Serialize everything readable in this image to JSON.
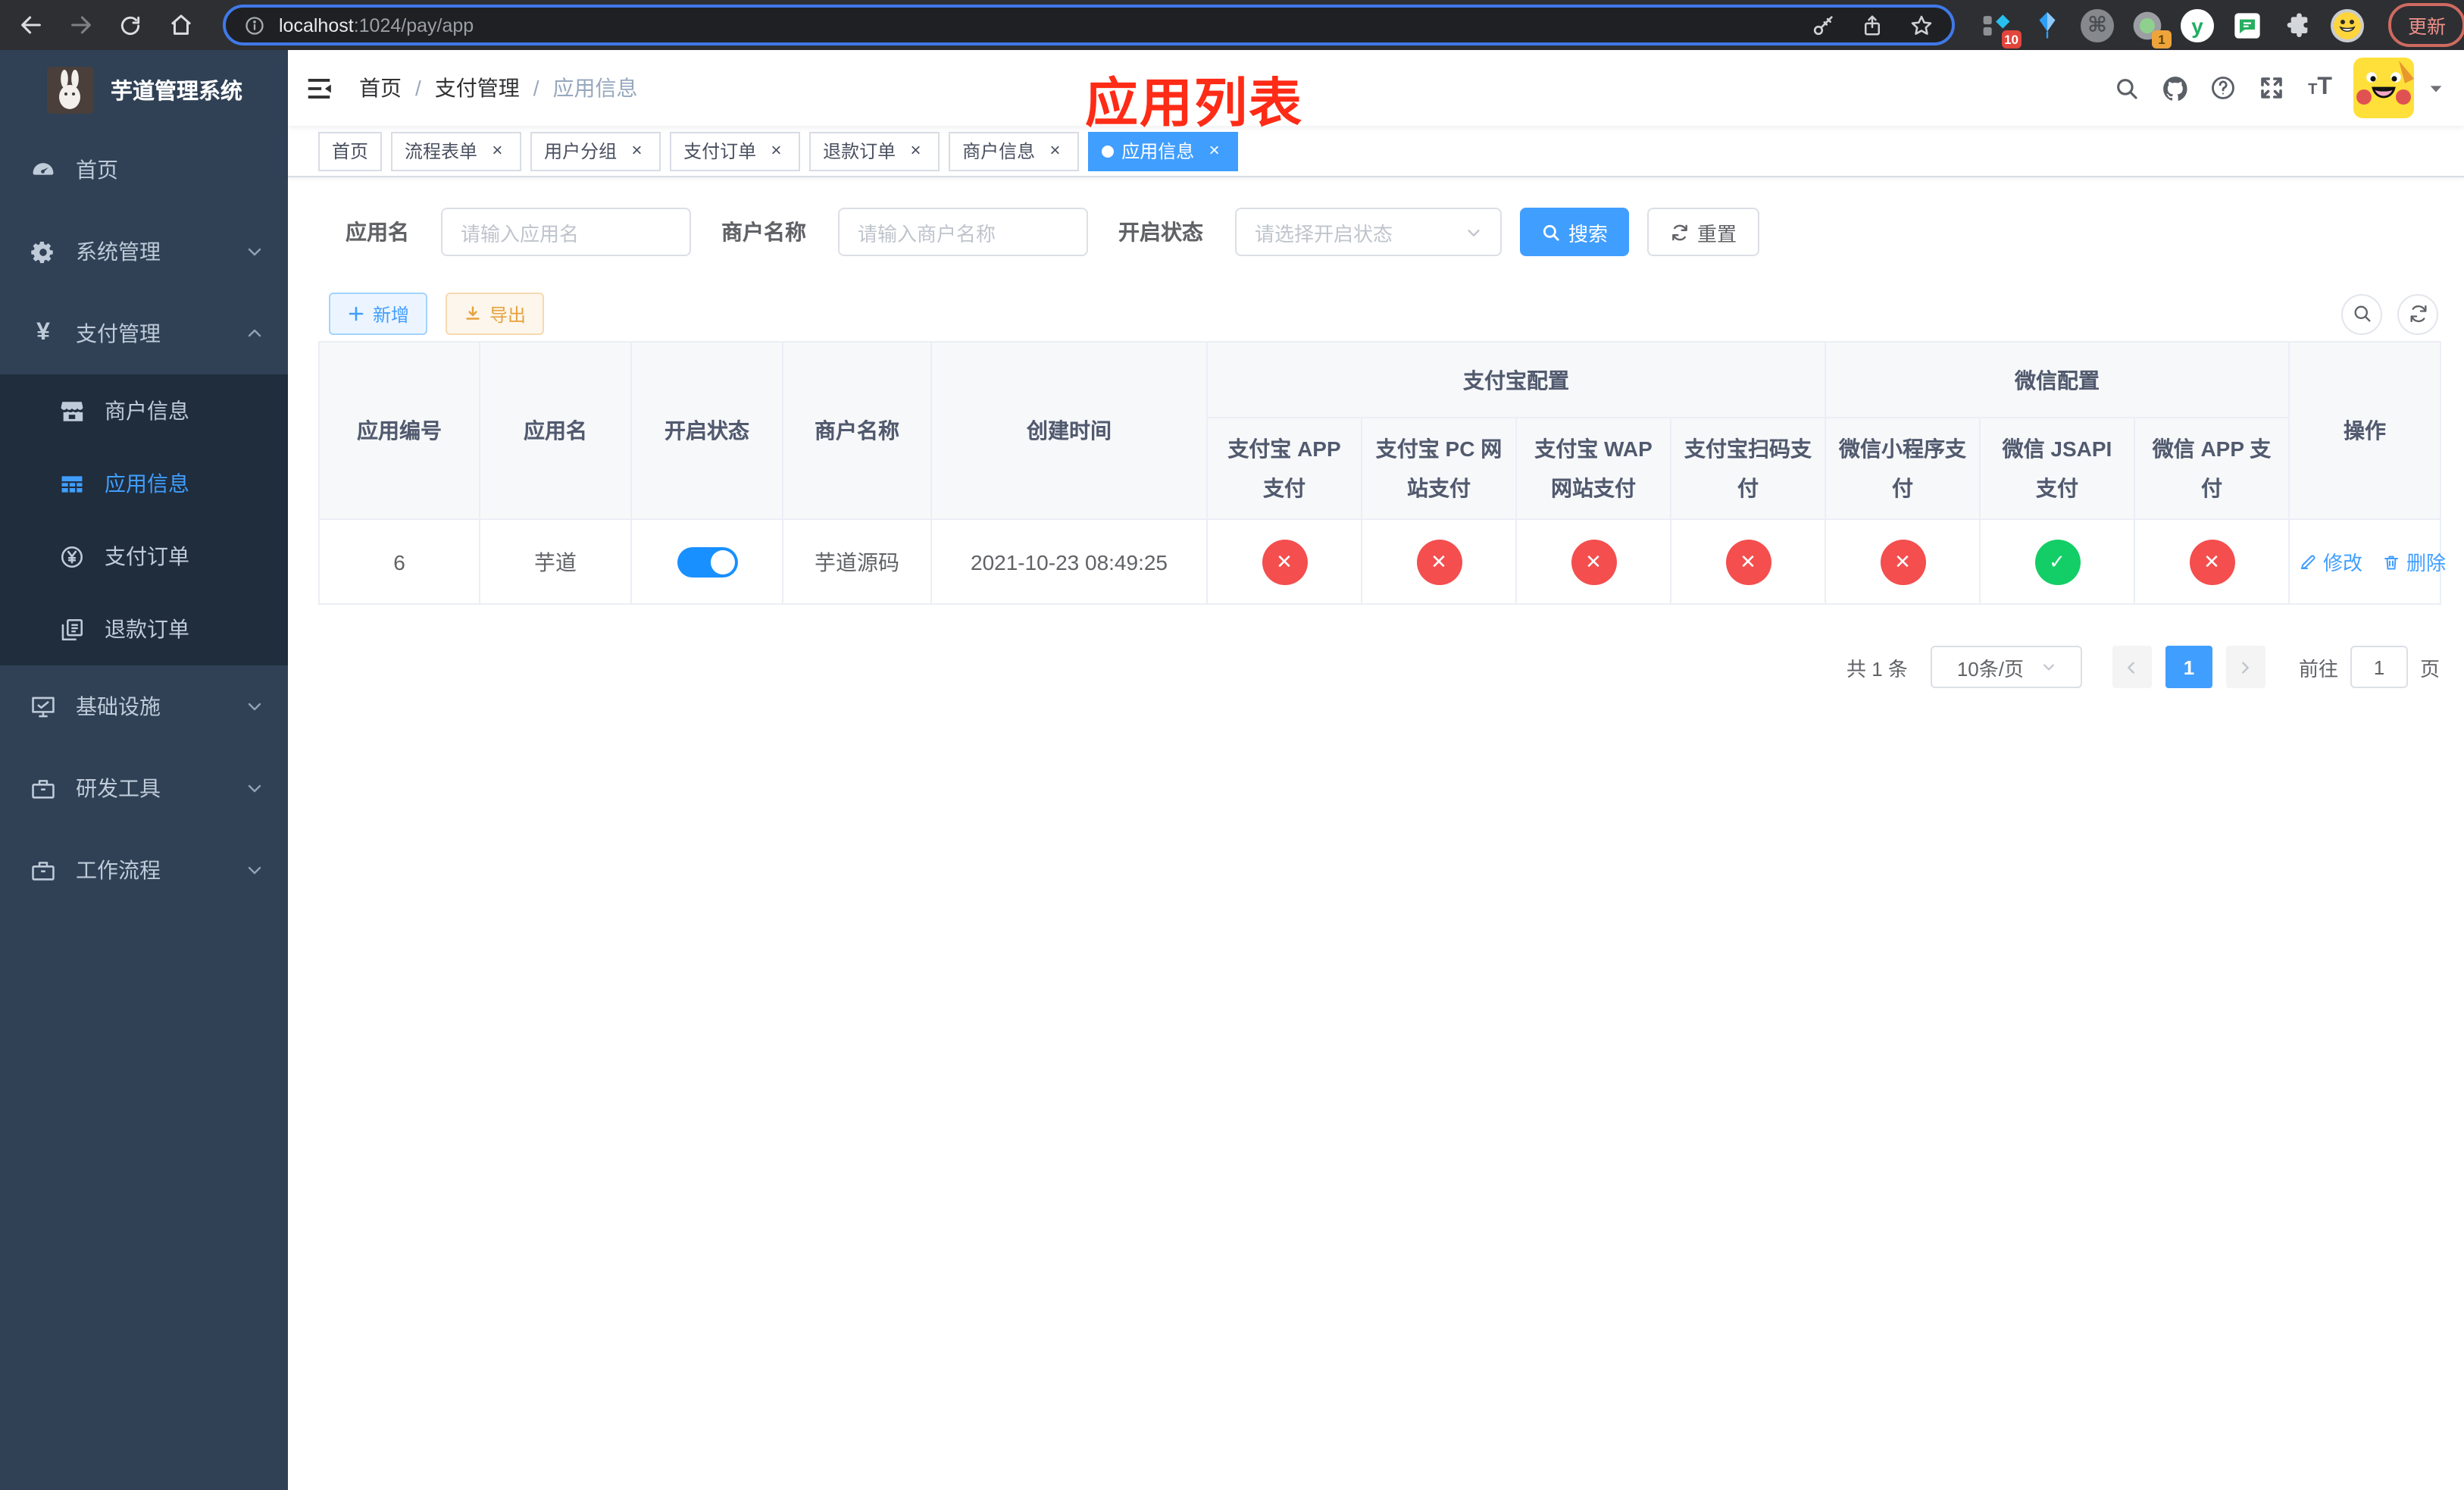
{
  "browser": {
    "url_host": "localhost",
    "url_rest": ":1024/pay/app",
    "update_label": "更新",
    "ext_badges": {
      "pinned": "10",
      "recorder": "1"
    }
  },
  "annotation": "应用列表",
  "sidebar": {
    "title": "芋道管理系统",
    "items_top": [
      {
        "label": "首页"
      },
      {
        "label": "系统管理"
      },
      {
        "label": "支付管理"
      }
    ],
    "payment_children": [
      {
        "label": "商户信息",
        "active": false
      },
      {
        "label": "应用信息",
        "active": true
      },
      {
        "label": "支付订单",
        "active": false
      },
      {
        "label": "退款订单",
        "active": false
      }
    ],
    "items_bottom": [
      {
        "label": "基础设施"
      },
      {
        "label": "研发工具"
      },
      {
        "label": "工作流程"
      }
    ]
  },
  "navbar": {
    "breadcrumb": [
      "首页",
      "支付管理",
      "应用信息"
    ],
    "separator": "/"
  },
  "tabs": [
    {
      "label": "首页",
      "closable": false,
      "active": false
    },
    {
      "label": "流程表单",
      "closable": true,
      "active": false
    },
    {
      "label": "用户分组",
      "closable": true,
      "active": false
    },
    {
      "label": "支付订单",
      "closable": true,
      "active": false
    },
    {
      "label": "退款订单",
      "closable": true,
      "active": false
    },
    {
      "label": "商户信息",
      "closable": true,
      "active": false
    },
    {
      "label": "应用信息",
      "closable": true,
      "active": true
    }
  ],
  "filters": {
    "app_name": {
      "label": "应用名",
      "placeholder": "请输入应用名"
    },
    "merchant_name": {
      "label": "商户名称",
      "placeholder": "请输入商户名称"
    },
    "status": {
      "label": "开启状态",
      "placeholder": "请选择开启状态"
    },
    "search": "搜索",
    "reset": "重置"
  },
  "toolbar": {
    "add": "新增",
    "export": "导出"
  },
  "table": {
    "headers": {
      "app_id": "应用编号",
      "app_name": "应用名",
      "status": "开启状态",
      "merchant": "商户名称",
      "created": "创建时间",
      "alipay_group": "支付宝配置",
      "wechat_group": "微信配置",
      "actions": "操作",
      "alipay_cols": [
        "支付宝 APP 支付",
        "支付宝 PC 网站支付",
        "支付宝 WAP 网站支付",
        "支付宝扫码支付"
      ],
      "wechat_cols": [
        "微信小程序支付",
        "微信 JSAPI 支付",
        "微信 APP 支付"
      ]
    },
    "row": {
      "app_id": "6",
      "app_name": "芋道",
      "enabled": true,
      "merchant": "芋道源码",
      "created": "2021-10-23 08:49:25",
      "pay_status": [
        "no",
        "no",
        "no",
        "no",
        "no",
        "yes",
        "no"
      ],
      "edit": "修改",
      "delete": "删除"
    }
  },
  "pagination": {
    "total": "共 1 条",
    "page_size": "10条/页",
    "page": "1",
    "goto_label": "前往",
    "goto_value": "1",
    "page_unit": "页"
  },
  "icons": {
    "check": "✓",
    "cross": "✕",
    "close": "×",
    "yen": "¥",
    "cmd": "⌘"
  },
  "colors": {
    "primary": "#409eff",
    "success": "#13ce66",
    "danger": "#f44e4e",
    "warning": "#e6a23c",
    "sidebar_bg": "#304156",
    "submenu_bg": "#1f2d3d",
    "annotation_red": "#fe2b16"
  }
}
